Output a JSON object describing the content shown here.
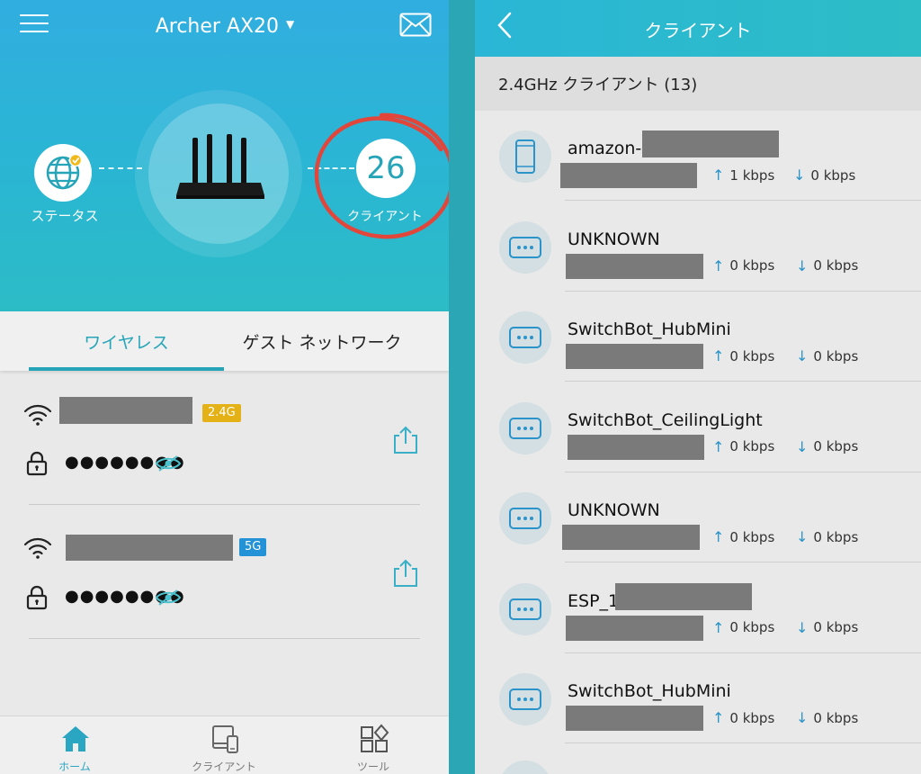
{
  "left": {
    "header": {
      "device_title": "Archer AX20",
      "status_label": "ステータス",
      "client_count": "26",
      "client_label": "クライアント"
    },
    "tabs": [
      {
        "label": "ワイヤレス",
        "active": true
      },
      {
        "label": "ゲスト ネットワーク",
        "active": false
      }
    ],
    "networks": [
      {
        "band": "2.4G",
        "band_color": "#e4b116",
        "password_mask": "●●●●●●●●"
      },
      {
        "band": "5G",
        "band_color": "#2392d6",
        "password_mask": "●●●●●●●●"
      }
    ],
    "bottom_nav": [
      {
        "label": "ホーム",
        "icon": "home-icon",
        "active": true
      },
      {
        "label": "クライアント",
        "icon": "devices-icon",
        "active": false
      },
      {
        "label": "ツール",
        "icon": "tools-icon",
        "active": false
      }
    ]
  },
  "right": {
    "title": "クライアント",
    "section_header": "2.4GHz クライアント (13)",
    "clients": [
      {
        "name": "amazon-",
        "icon": "phone-icon",
        "up": "1 kbps",
        "down": "0 kbps"
      },
      {
        "name": "UNKNOWN",
        "icon": "generic-device-icon",
        "up": "0 kbps",
        "down": "0 kbps"
      },
      {
        "name": "SwitchBot_HubMini",
        "icon": "generic-device-icon",
        "up": "0 kbps",
        "down": "0 kbps"
      },
      {
        "name": "SwitchBot_CeilingLight",
        "icon": "generic-device-icon",
        "up": "0 kbps",
        "down": "0 kbps"
      },
      {
        "name": "UNKNOWN",
        "icon": "generic-device-icon",
        "up": "0 kbps",
        "down": "0 kbps"
      },
      {
        "name": "ESP_1",
        "icon": "generic-device-icon",
        "up": "0 kbps",
        "down": "0 kbps"
      },
      {
        "name": "SwitchBot_HubMini",
        "icon": "generic-device-icon",
        "up": "0 kbps",
        "down": "0 kbps"
      }
    ]
  },
  "colors": {
    "accent": "#26a5b8",
    "header_gradient_start": "#31aee0",
    "header_gradient_end": "#2cbcc6",
    "annotation_red": "#e2453a"
  }
}
